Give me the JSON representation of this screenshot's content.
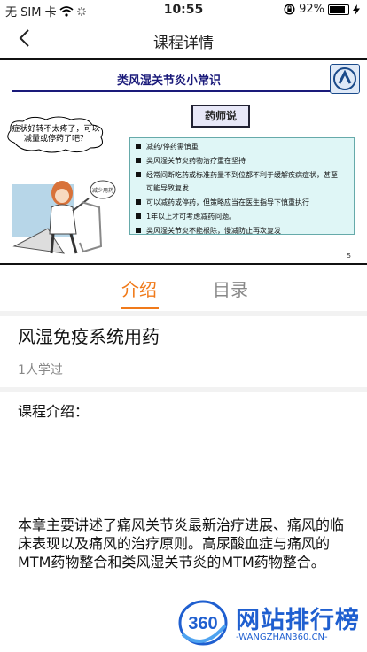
{
  "status": {
    "carrier": "无 SIM 卡",
    "time": "10:55",
    "battery": "92%",
    "battery_level": 0.92
  },
  "nav": {
    "title": "课程详情"
  },
  "slide": {
    "title": "类风湿关节炎小常识",
    "badge": "药师说",
    "bubble": "症状好转不太疼了，可以减量或停药了吧？",
    "sign": "减少用药",
    "page": "5",
    "bullets": [
      "减药/停药需慎重",
      "类风湿关节炎药物治疗重在坚持",
      "经常间断吃药或标准药量不到位都不利于缓解疾病症状，甚至",
      "可能导致复发",
      "可以减药或停药，但策略应当在医生指导下慎重执行",
      "1年以上才可考虑减药问题。",
      "类风湿关节炎不能根除，慢减防止再次复发"
    ]
  },
  "tabs": [
    {
      "label": "介绍"
    },
    {
      "label": "目录"
    }
  ],
  "course": {
    "title": "风湿免疫系统用药",
    "learned": "1人学过",
    "intro_label": "课程介绍：",
    "intro_text": "本章主要讲述了痛风关节炎最新治疗进展、痛风的临床表现以及痛风的治疗原则。高尿酸血症与痛风的MTM药物整合和类风湿关节炎的MTM药物整合。"
  },
  "watermark": {
    "number": "360",
    "main": "网站排行榜",
    "sub": "-WANGZHAN360.CN-"
  }
}
